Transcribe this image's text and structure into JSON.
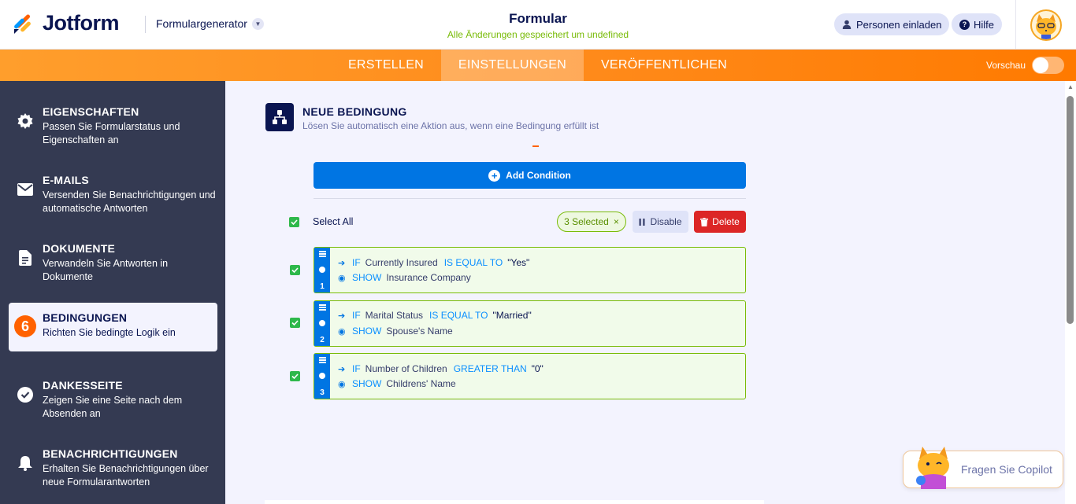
{
  "header": {
    "brand": "Jotform",
    "form_generator": "Formulargenerator",
    "form_title": "Formular",
    "save_status": "Alle Änderungen gespeichert um undefined",
    "invite_label": "Personen einladen",
    "help_label": "Hilfe"
  },
  "nav": {
    "tabs": [
      "ERSTELLEN",
      "EINSTELLUNGEN",
      "VERÖFFENTLICHEN"
    ],
    "active_tab": "EINSTELLUNGEN",
    "preview_label": "Vorschau",
    "preview_enabled": false
  },
  "sidebar": {
    "items": [
      {
        "title": "EIGENSCHAFTEN",
        "desc": "Passen Sie Formularstatus und Eigenschaften an",
        "icon": "gear-icon"
      },
      {
        "title": "E-MAILS",
        "desc": "Versenden Sie Benachrichtigungen und automatische Antworten",
        "icon": "envelope-icon"
      },
      {
        "title": "DOKUMENTE",
        "desc": "Verwandeln Sie Antworten in Dokumente",
        "icon": "document-icon"
      },
      {
        "title": "BEDINGUNGEN",
        "desc": "Richten Sie bedingte Logik ein",
        "icon": "step-badge",
        "badge": "6",
        "active": true
      },
      {
        "title": "DANKESSEITE",
        "desc": "Zeigen Sie eine Seite nach dem Absenden an",
        "icon": "check-circle-icon"
      },
      {
        "title": "BENACHRICHTIGUNGEN",
        "desc": "Erhalten Sie Benachrichtigungen über neue Formularantworten",
        "icon": "bell-icon"
      }
    ]
  },
  "condition_panel": {
    "title": "NEUE BEDINGUNG",
    "subtitle": "Lösen Sie automatisch eine Aktion aus, wenn eine Bedingung erfüllt ist",
    "add_button": "Add Condition",
    "select_all": "Select All",
    "selected_count": "3 Selected",
    "disable_label": "Disable",
    "delete_label": "Delete",
    "conditions": [
      {
        "num": "1",
        "if_kw": "IF",
        "field": "Currently Insured",
        "operator": "IS EQUAL TO",
        "value": "\"Yes\"",
        "action_kw": "SHOW",
        "target": "Insurance Company",
        "checked": true
      },
      {
        "num": "2",
        "if_kw": "IF",
        "field": "Marital Status",
        "operator": "IS EQUAL TO",
        "value": "\"Married\"",
        "action_kw": "SHOW",
        "target": "Spouse's Name",
        "checked": true
      },
      {
        "num": "3",
        "if_kw": "IF",
        "field": "Number of Children",
        "operator": "GREATER THAN",
        "value": "\"0\"",
        "action_kw": "SHOW",
        "target": "Childrens' Name",
        "checked": true
      }
    ]
  },
  "copilot": {
    "label": "Fragen Sie Copilot"
  },
  "colors": {
    "brand_orange": "#ff7a00",
    "sidebar_bg": "#343a52",
    "primary_blue": "#0075e3",
    "success_green": "#78bb07",
    "danger_red": "#dc2626",
    "navy": "#0a1551"
  }
}
